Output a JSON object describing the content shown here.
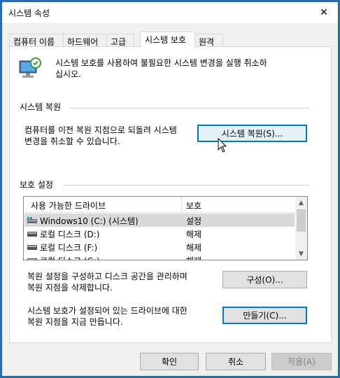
{
  "window": {
    "title": "시스템 속성"
  },
  "tabs": [
    {
      "label": "컴퓨터 이름"
    },
    {
      "label": "하드웨어"
    },
    {
      "label": "고급"
    },
    {
      "label": "시스템 보호"
    },
    {
      "label": "원격"
    }
  ],
  "active_tab": "시스템 보호",
  "intro": {
    "line1": "시스템 보호를 사용하여 불필요한 시스템 변경을 실행 취소하",
    "line2": "십시오."
  },
  "restore_section": {
    "heading": "시스템 복원",
    "desc_line1": "컴퓨터를 이전 복원 지점으로 되돌려 시스템",
    "desc_line2": "변경을 취소할 수 있습니다.",
    "button": "시스템 복원(S)..."
  },
  "protection_section": {
    "heading": "보호 설정",
    "columns": {
      "drive": "사용 가능한 드라이브",
      "protection": "보호"
    },
    "drives": [
      {
        "name": "Windows10 (C:) (시스템)",
        "protection": "설정",
        "icon": "system-drive-icon",
        "selected": true
      },
      {
        "name": "로컬 디스크 (D:)",
        "protection": "해제",
        "icon": "hard-drive-icon",
        "selected": false
      },
      {
        "name": "로컬 디스크 (F:)",
        "protection": "해제",
        "icon": "hard-drive-icon",
        "selected": false
      },
      {
        "name": "로컬 디스크 (G:)",
        "protection": "해제",
        "icon": "hard-drive-icon",
        "selected": false
      }
    ],
    "configure_line1": "복원 설정을 구성하고 디스크 공간을 관리하며",
    "configure_line2": "복원 지점을 삭제합니다.",
    "configure_button": "구성(O)...",
    "create_line1": "시스템 보호가 설정되어 있는 드라이브에 대한",
    "create_line2": "복원 지점을 지금 만듭니다.",
    "create_button": "만들기(C)..."
  },
  "footer": {
    "ok": "확인",
    "cancel": "취소",
    "apply": "적용(A)"
  }
}
